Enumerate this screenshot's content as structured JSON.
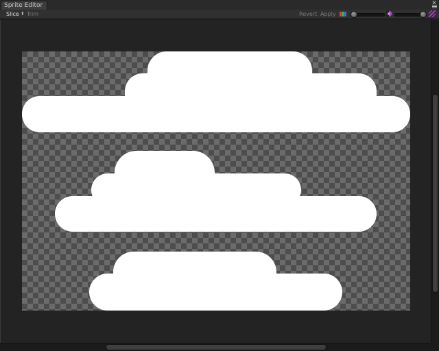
{
  "window": {
    "tab_title": "Sprite Editor",
    "close_glyph": "✕"
  },
  "toolbar": {
    "slice_label": "Slice",
    "slice_dropdown_glyph": "⬍",
    "trim_label": "Trim",
    "revert_label": "Revert",
    "apply_label": "Apply",
    "icons": {
      "rgb": "rgb-channels-icon",
      "alpha": "alpha-channel-icon",
      "mip": "mip-level-icon"
    }
  },
  "colors": {
    "background": "#1f1f1f",
    "checker_dark": "#4d4d4d",
    "checker_light": "#6b6b6b",
    "sprite": "#ffffff",
    "accent_alpha": "#b040d0"
  }
}
